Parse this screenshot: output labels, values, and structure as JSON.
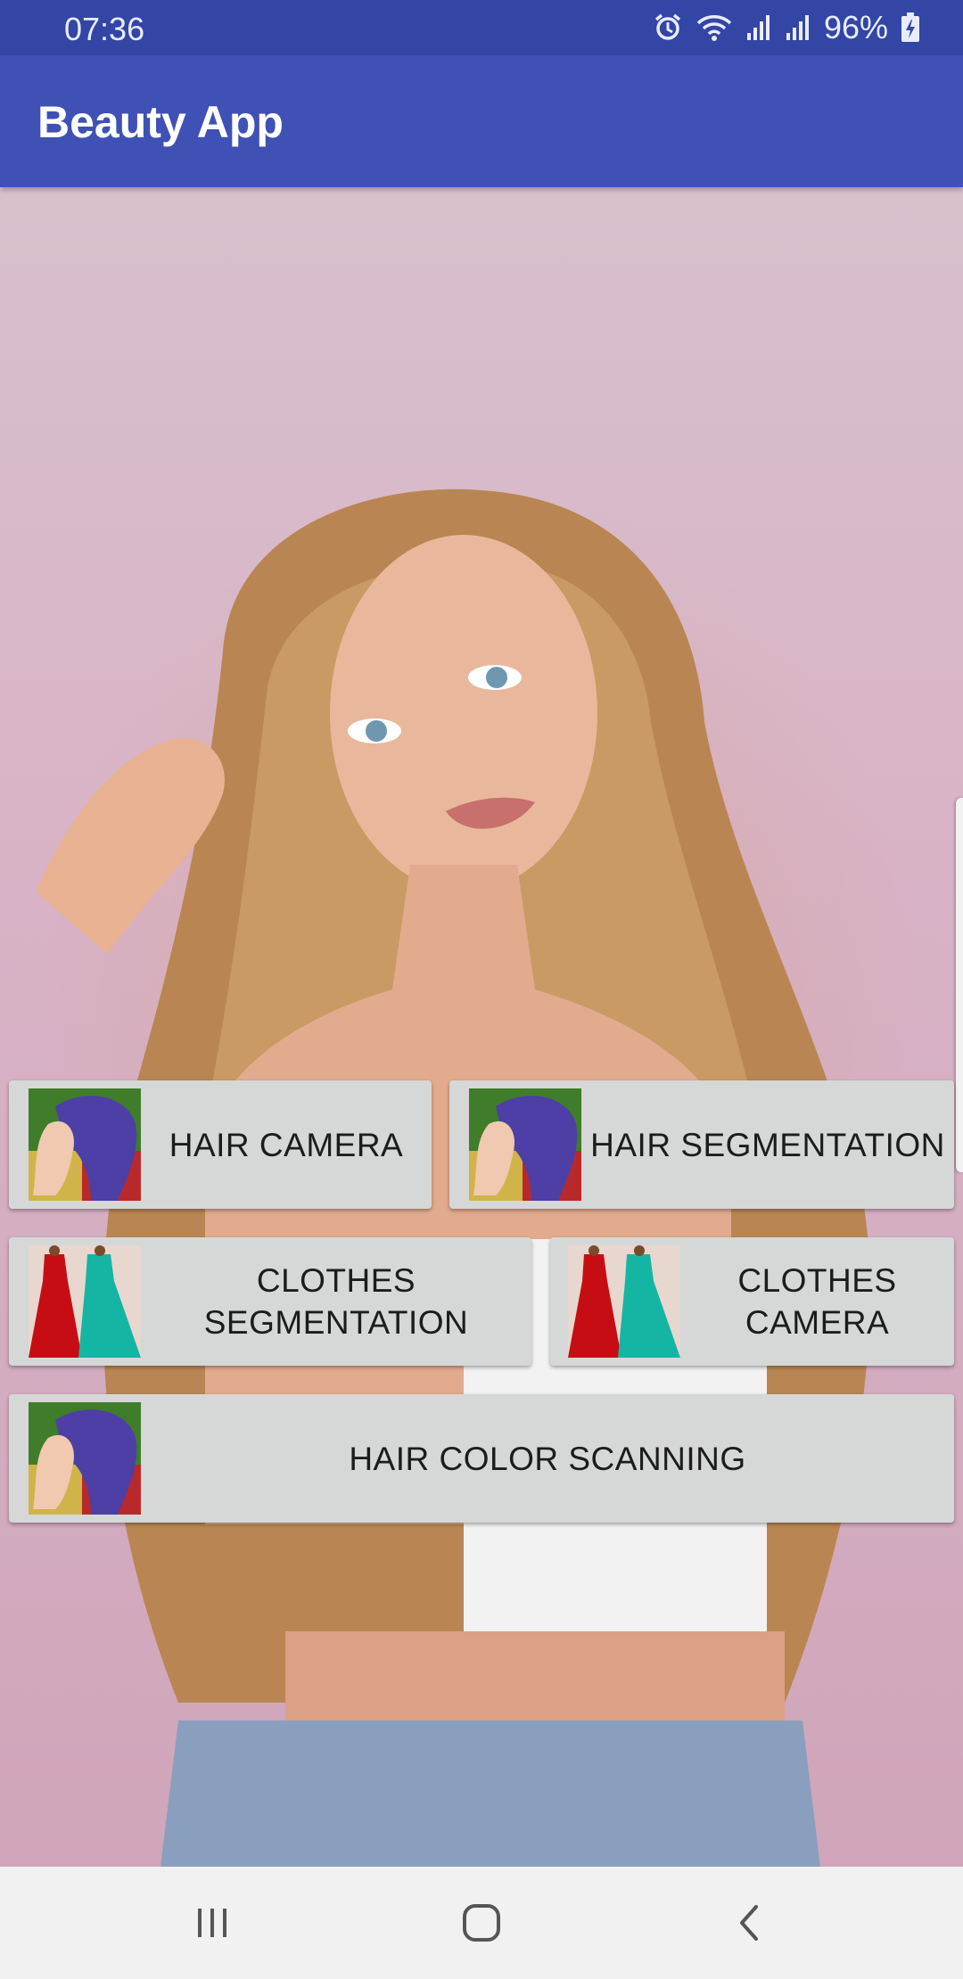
{
  "status_bar": {
    "time": "07:36",
    "battery": "96%",
    "icons": [
      "alarm-icon",
      "wifi-icon",
      "signal-icon",
      "signal-icon",
      "battery-charging-icon"
    ]
  },
  "app_bar": {
    "title": "Beauty App"
  },
  "buttons": {
    "hair_camera": "HAIR CAMERA",
    "hair_segmentation": "HAIR SEGMENTATION",
    "clothes_segmentation_line1": "CLOTHES",
    "clothes_segmentation_line2": "SEGMENTATION",
    "clothes_camera_line1": "CLOTHES",
    "clothes_camera_line2": "CAMERA",
    "hair_color_scanning": "HAIR COLOR SCANNING"
  },
  "nav_bar": {
    "icons": [
      "recent-apps-icon",
      "home-icon",
      "back-icon"
    ]
  },
  "colors": {
    "status_bar": "#3345a5",
    "app_bar": "#3f51b5",
    "button_bg": "#d6d7d7"
  }
}
